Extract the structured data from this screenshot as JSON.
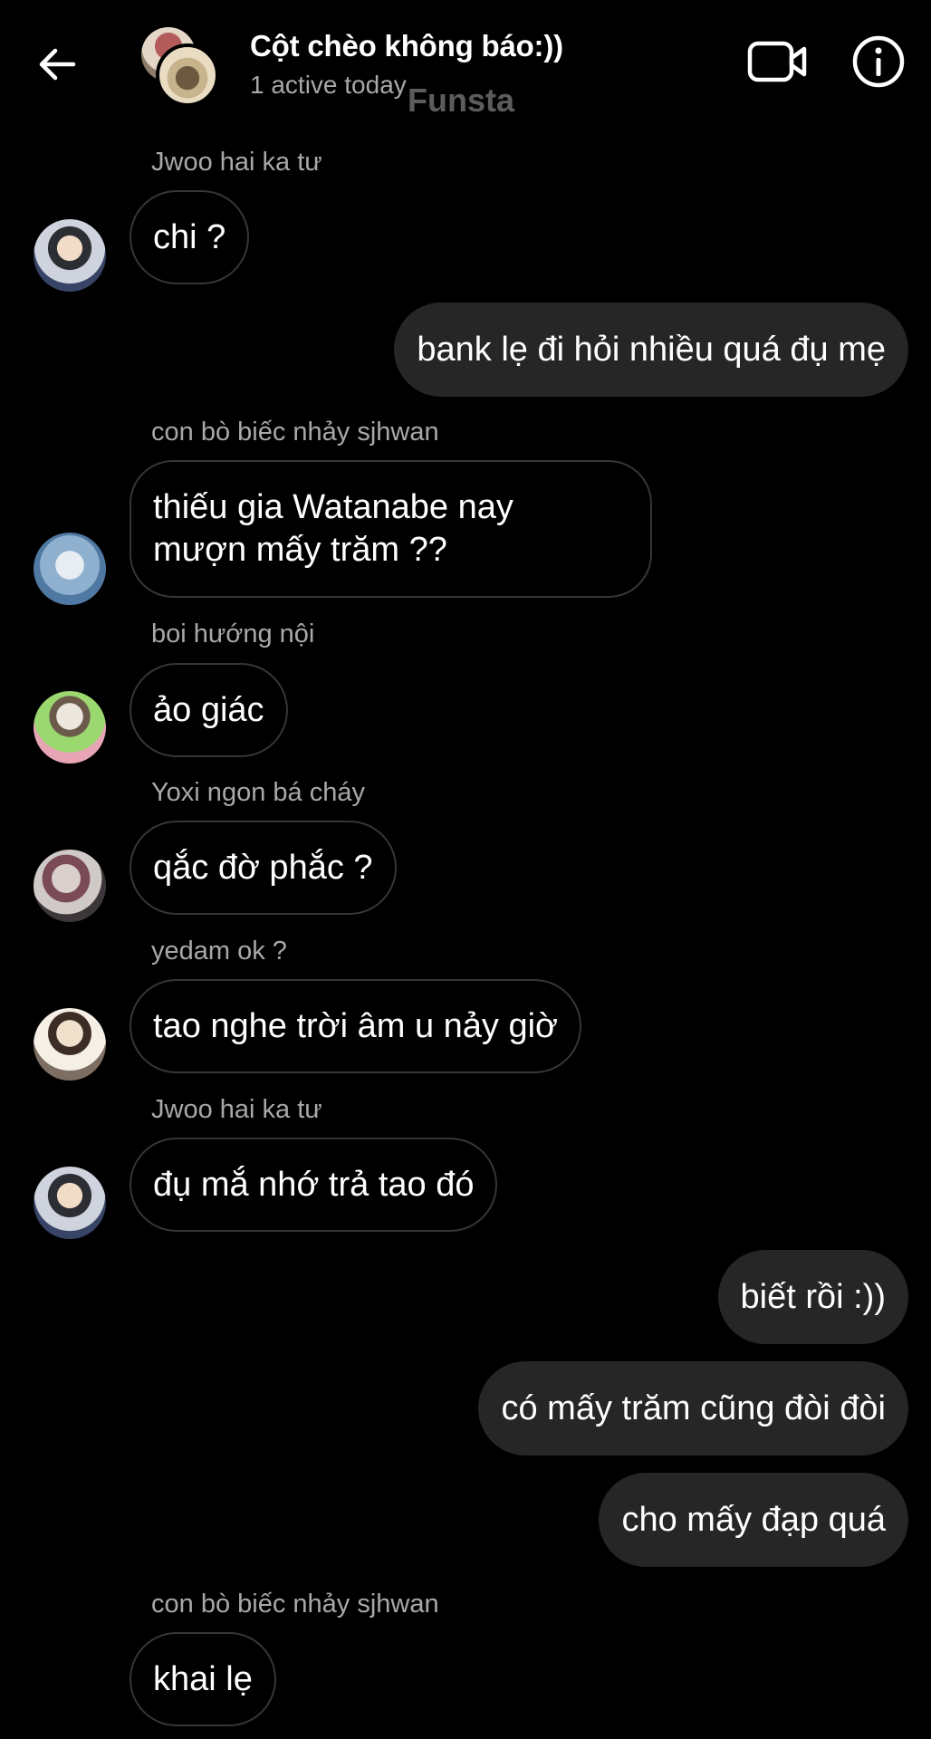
{
  "header": {
    "title": "Cột chèo không báo:))",
    "subtitle": "1 active today",
    "watermark": "Funsta",
    "icons": {
      "back": "arrow-left-icon",
      "video": "video-camera-icon",
      "info": "info-icon"
    }
  },
  "messages": {
    "m1": {
      "sender": "Jwoo hai ka tư",
      "text": "chi ?"
    },
    "m2": {
      "text": "bank lẹ đi hỏi nhiều quá đụ mẹ"
    },
    "m3": {
      "sender": "con bò biếc nhảy sjhwan",
      "line1": "thiếu gia Watanabe nay",
      "line2": "mượn mấy trăm ??"
    },
    "m4": {
      "sender": "boi hướng nội",
      "text": "ảo giác"
    },
    "m5": {
      "sender": "Yoxi ngon bá cháy",
      "text": "qắc đờ phắc ?"
    },
    "m6": {
      "sender": "yedam ok ?",
      "text": "tao nghe trời âm u nảy giờ"
    },
    "m7": {
      "sender": "Jwoo hai ka tư",
      "text": "đụ mắ nhớ trả tao đó"
    },
    "m8": {
      "text": "biết rồi :))"
    },
    "m9": {
      "text": "có mấy trăm cũng đòi đòi"
    },
    "m10": {
      "text": "cho mấy đạp quá"
    },
    "m11": {
      "sender": "con bò biếc nhảy sjhwan",
      "text": "khai lẹ"
    }
  },
  "colors": {
    "background": "#000000",
    "outgoing_bubble": "#262626",
    "incoming_border": "#363636",
    "secondary_text": "#a8a8a8"
  }
}
